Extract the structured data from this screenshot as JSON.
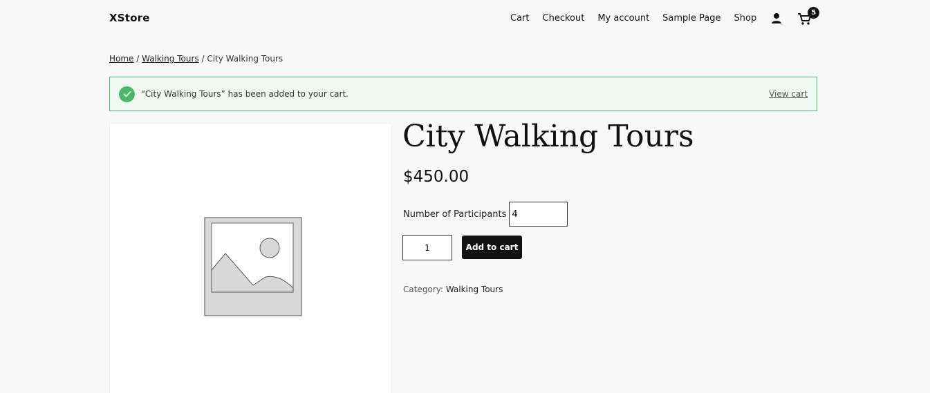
{
  "site": {
    "title": "XStore"
  },
  "nav": {
    "items": [
      "Cart",
      "Checkout",
      "My account",
      "Sample Page",
      "Shop"
    ],
    "account_icon": "person-icon",
    "cart_icon": "cart-icon",
    "cart_count": "5"
  },
  "breadcrumb": {
    "home": "Home",
    "sep1": " / ",
    "category": "Walking Tours",
    "sep2": " / ",
    "current": "City Walking Tours"
  },
  "notice": {
    "text": "“City Walking Tours” has been added to your cart.",
    "link": "View cart",
    "accent": "#4ab866"
  },
  "product": {
    "title": "City Walking Tours",
    "price": "$450.00",
    "participants_label": "Number of Participants",
    "participants_value": "4",
    "quantity": "1",
    "add_to_cart": "Add to cart",
    "category_label": "Category: ",
    "category": "Walking Tours"
  }
}
